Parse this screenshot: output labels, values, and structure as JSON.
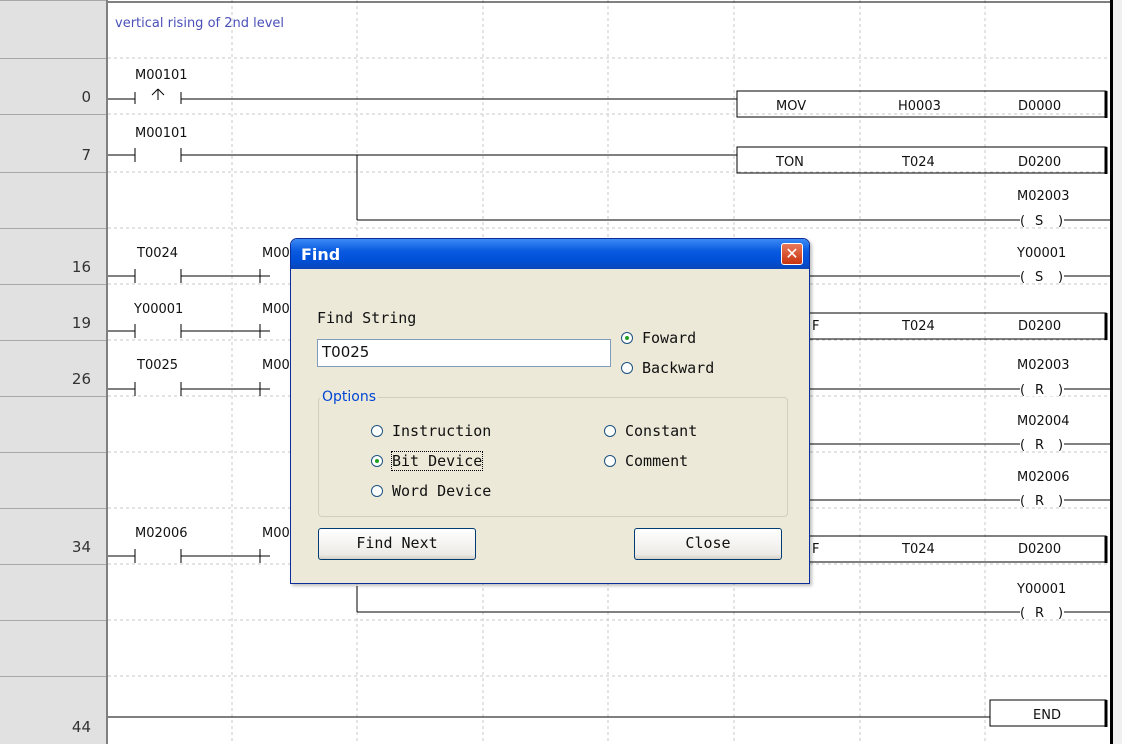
{
  "editor": {
    "comment": "vertical rising of 2nd level",
    "rung_numbers": [
      "0",
      "7",
      "16",
      "19",
      "26",
      "34",
      "44"
    ],
    "contacts": [
      "M00101",
      "M00101",
      "T0024",
      "M00",
      "Y00001",
      "M00",
      "T0025",
      "M00",
      "M02006",
      "M00"
    ],
    "coils": [
      "M02003",
      "Y00001",
      "M02003",
      "M02004",
      "M02006",
      "Y00001"
    ],
    "coil_types": [
      "S",
      "S",
      "R",
      "R",
      "R",
      "R"
    ],
    "instructions": [
      {
        "op": "MOV",
        "a": "H0003",
        "b": "D0000"
      },
      {
        "op": "TON",
        "a": "T024",
        "b": "D0200"
      },
      {
        "op": "F",
        "a": "T024",
        "b": "D0200"
      },
      {
        "op": "F",
        "a": "T024",
        "b": "D0200"
      }
    ],
    "end_label": "END"
  },
  "dialog": {
    "title": "Find",
    "close_glyph": "✕",
    "find_string_label": "Find String",
    "find_string_value": "T0025",
    "direction": {
      "forward": "Foward",
      "backward": "Backward",
      "selected": "Foward"
    },
    "options_label": "Options",
    "options": {
      "instruction": "Instruction",
      "bit_device": "Bit Device",
      "word_device": "Word Device",
      "constant": "Constant",
      "comment": "Comment",
      "selected": "Bit Device"
    },
    "find_next": "Find Next",
    "close": "Close"
  }
}
